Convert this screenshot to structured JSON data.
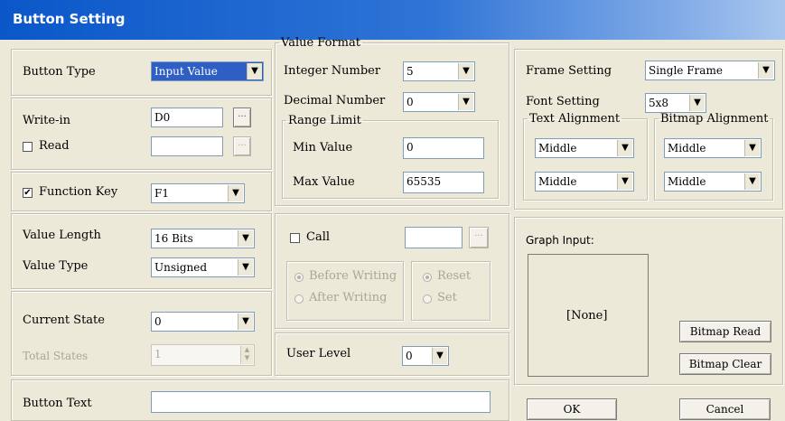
{
  "window": {
    "title": "Button Setting"
  },
  "button_type": {
    "label": "Button Type",
    "value": "Input Value"
  },
  "write_in": {
    "label": "Write-in",
    "value": "D0",
    "browse": "..."
  },
  "read": {
    "label": "Read",
    "checked": false,
    "value": "",
    "browse": "..."
  },
  "function_key": {
    "label": "Function Key",
    "checked": true,
    "value": "F1",
    "check_mark": "✔"
  },
  "value_format": {
    "legend": "Value Format",
    "integer_label": "Integer Number",
    "integer_value": "5",
    "decimal_label": "Decimal Number",
    "decimal_value": "0",
    "range_legend": "Range Limit",
    "min_label": "Min Value",
    "min_value": "0",
    "max_label": "Max Value",
    "max_value": "65535"
  },
  "frame_setting": {
    "label": "Frame Setting",
    "value": "Single Frame"
  },
  "font_setting": {
    "label": "Font Setting",
    "value": "5x8"
  },
  "text_alignment": {
    "legend": "Text Alignment",
    "horizontal": "Middle",
    "vertical": "Middle"
  },
  "bitmap_alignment": {
    "legend": "Bitmap Alignment",
    "horizontal": "Middle",
    "vertical": "Middle"
  },
  "value_length": {
    "label": "Value Length",
    "value": "16 Bits"
  },
  "value_type": {
    "label": "Value Type",
    "value": "Unsigned"
  },
  "call": {
    "label": "Call",
    "checked": false,
    "value": "",
    "browse": "..."
  },
  "before_writing": {
    "label": "Before Writing"
  },
  "after_writing": {
    "label": "After Writing"
  },
  "reset": {
    "label": "Reset"
  },
  "set": {
    "label": "Set"
  },
  "graph_input": {
    "label": "Graph Input:",
    "placeholder": "[None]"
  },
  "bitmap_read": {
    "label": "Bitmap Read"
  },
  "bitmap_clear": {
    "label": "Bitmap Clear"
  },
  "current_state": {
    "label": "Current State",
    "value": "0"
  },
  "total_states": {
    "label": "Total States",
    "value": "1"
  },
  "user_level": {
    "label": "User Level",
    "value": "0"
  },
  "button_text": {
    "label": "Button Text",
    "value": ""
  },
  "ok": {
    "label": "OK"
  },
  "cancel": {
    "label": "Cancel"
  },
  "icons": {
    "dropdown": "▼",
    "spin_up": "▲",
    "spin_down": "▼"
  },
  "colors": {
    "titlebar": "#0a57c9",
    "dialog": "#ece9d8",
    "selected": "#2f5fc4"
  }
}
